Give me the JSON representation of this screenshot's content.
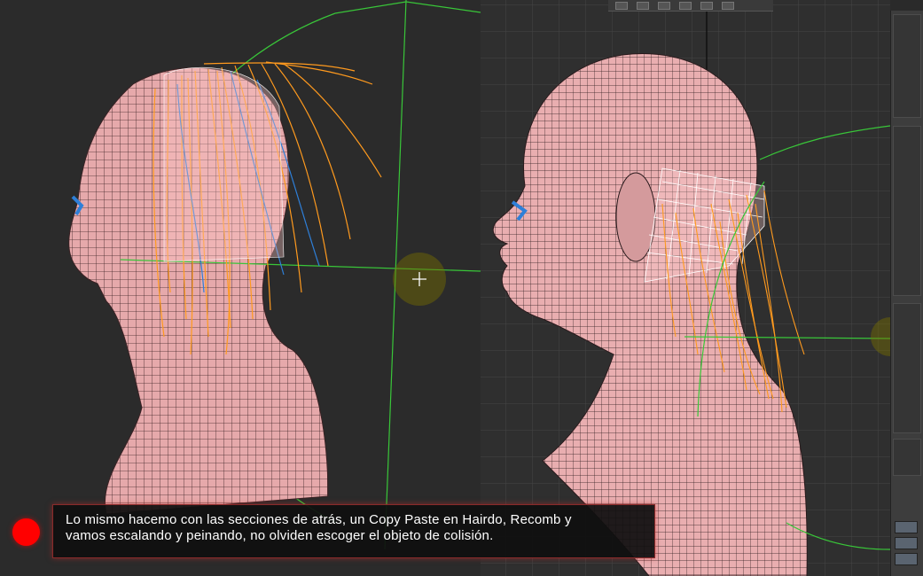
{
  "caption": {
    "line1": "Lo mismo hacemo con las secciones de atrás, un Copy Paste en Hairdo, Recomb y",
    "line2": " vamos escalando y peinando, no olviden escoger el objeto de colisión."
  },
  "icons": {
    "record": "record-dot-icon",
    "move_gizmo": "move-gizmo-icon"
  },
  "colors": {
    "skin": "#e9aeb0",
    "wire": "#2a1a1c",
    "hair_guides": "#ff9a1e",
    "guide_selected": "#2e7fd8",
    "spline": "#39c639",
    "record": "#ff0000"
  }
}
